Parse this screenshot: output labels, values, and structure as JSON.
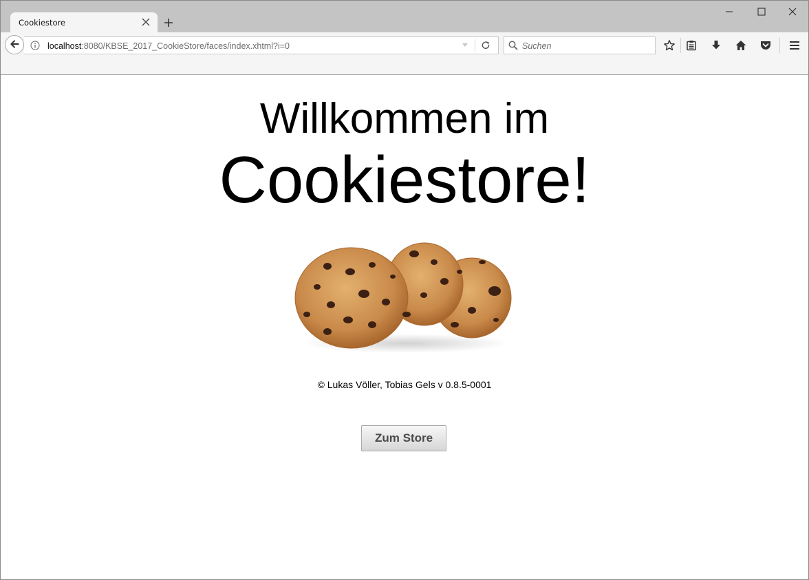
{
  "browser": {
    "tab": {
      "title": "Cookiestore"
    },
    "url": {
      "host": "localhost",
      "rest": ":8080/KBSE_2017_CookieStore/faces/index.xhtml?i=0"
    },
    "search": {
      "placeholder": "Suchen"
    },
    "icons": {
      "tab_close": "close-icon",
      "new_tab": "plus-icon",
      "minimize": "minimize-icon",
      "maximize": "maximize-icon",
      "close": "close-window-icon",
      "back": "back-arrow-icon",
      "info": "info-icon",
      "dropdown": "chevron-down-icon",
      "reload": "reload-icon",
      "search": "search-icon",
      "bookmark": "star-icon",
      "reading_list": "clipboard-icon",
      "downloads": "download-icon",
      "home": "home-icon",
      "pocket": "pocket-icon",
      "menu": "hamburger-menu-icon"
    }
  },
  "page": {
    "heading_line1": "Willkommen im",
    "heading_line2": "Cookiestore!",
    "image": "cookies-image",
    "copyright": "© Lukas Völler, Tobias Gels v 0.8.5-0001",
    "store_button": "Zum Store"
  },
  "colors": {
    "tabstrip": "#c4c4c4",
    "toolbar": "#f5f5f5",
    "button_text": "#4a4a4a",
    "cookie": "#c98a4a"
  }
}
